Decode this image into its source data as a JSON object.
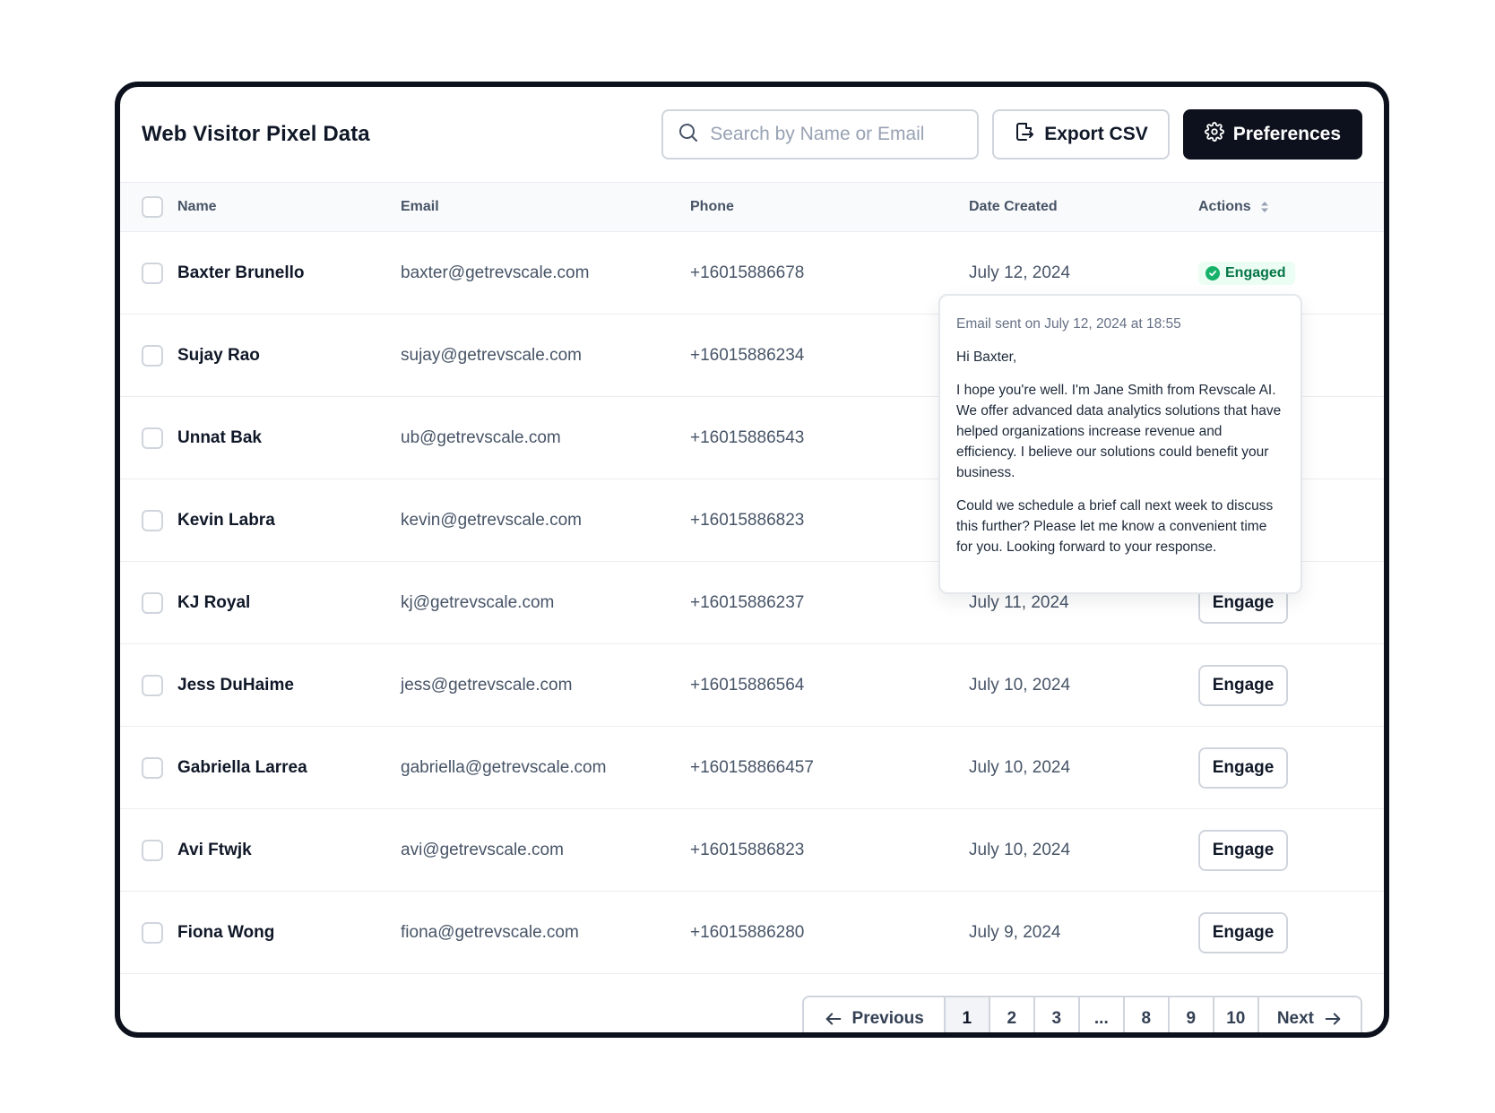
{
  "header": {
    "title": "Web Visitor Pixel Data",
    "search_placeholder": "Search by Name or Email",
    "search_value": "",
    "export_label": "Export CSV",
    "preferences_label": "Preferences"
  },
  "columns": {
    "name": "Name",
    "email": "Email",
    "phone": "Phone",
    "date": "Date Created",
    "actions": "Actions"
  },
  "rows": [
    {
      "name": "Baxter Brunello",
      "email": "baxter@getrevscale.com",
      "phone": "+16015886678",
      "date": "July 12, 2024",
      "action": "Engaged"
    },
    {
      "name": "Sujay Rao",
      "email": "sujay@getrevscale.com",
      "phone": "+16015886234",
      "date": "",
      "action": ""
    },
    {
      "name": "Unnat Bak",
      "email": "ub@getrevscale.com",
      "phone": "+16015886543",
      "date": "",
      "action": ""
    },
    {
      "name": "Kevin Labra",
      "email": "kevin@getrevscale.com",
      "phone": "+16015886823",
      "date": "",
      "action": ""
    },
    {
      "name": "KJ Royal",
      "email": "kj@getrevscale.com",
      "phone": "+16015886237",
      "date": "July 11, 2024",
      "action": "Engage"
    },
    {
      "name": "Jess DuHaime",
      "email": "jess@getrevscale.com",
      "phone": "+16015886564",
      "date": "July 10, 2024",
      "action": "Engage"
    },
    {
      "name": "Gabriella Larrea",
      "email": "gabriella@getrevscale.com",
      "phone": "+160158866457",
      "date": "July 10, 2024",
      "action": "Engage"
    },
    {
      "name": "Avi Ftwjk",
      "email": "avi@getrevscale.com",
      "phone": "+16015886823",
      "date": "July 10, 2024",
      "action": "Engage"
    },
    {
      "name": "Fiona Wong",
      "email": "fiona@getrevscale.com",
      "phone": "+16015886280",
      "date": "July 9, 2024",
      "action": "Engage"
    }
  ],
  "popover": {
    "meta": "Email sent on July 12, 2024 at 18:55",
    "greeting": "Hi Baxter,",
    "paragraph1": "I hope you're well. I'm Jane Smith from Revscale AI. We offer advanced data analytics solutions that have helped organizations increase revenue and efficiency. I believe our solutions could benefit your business.",
    "paragraph2": "Could we schedule a brief call next week to discuss this further? Please let me know a convenient time for you. Looking forward to your response."
  },
  "pagination": {
    "previous_label": "Previous",
    "next_label": "Next",
    "pages": [
      "1",
      "2",
      "3",
      "...",
      "8",
      "9",
      "10"
    ],
    "current_page": "1"
  },
  "colors": {
    "primary": "#0c111d",
    "engaged_bg": "#ecfdf3",
    "engaged_text": "#067647",
    "engaged_dot": "#17b26a",
    "border": "#d0d5dd"
  },
  "icons": {
    "search": "search-icon",
    "export": "export-file-icon",
    "preferences": "gear-icon",
    "sort": "sort-icon",
    "engaged": "check-circle-icon",
    "previous": "arrow-left-icon",
    "next": "arrow-right-icon"
  }
}
